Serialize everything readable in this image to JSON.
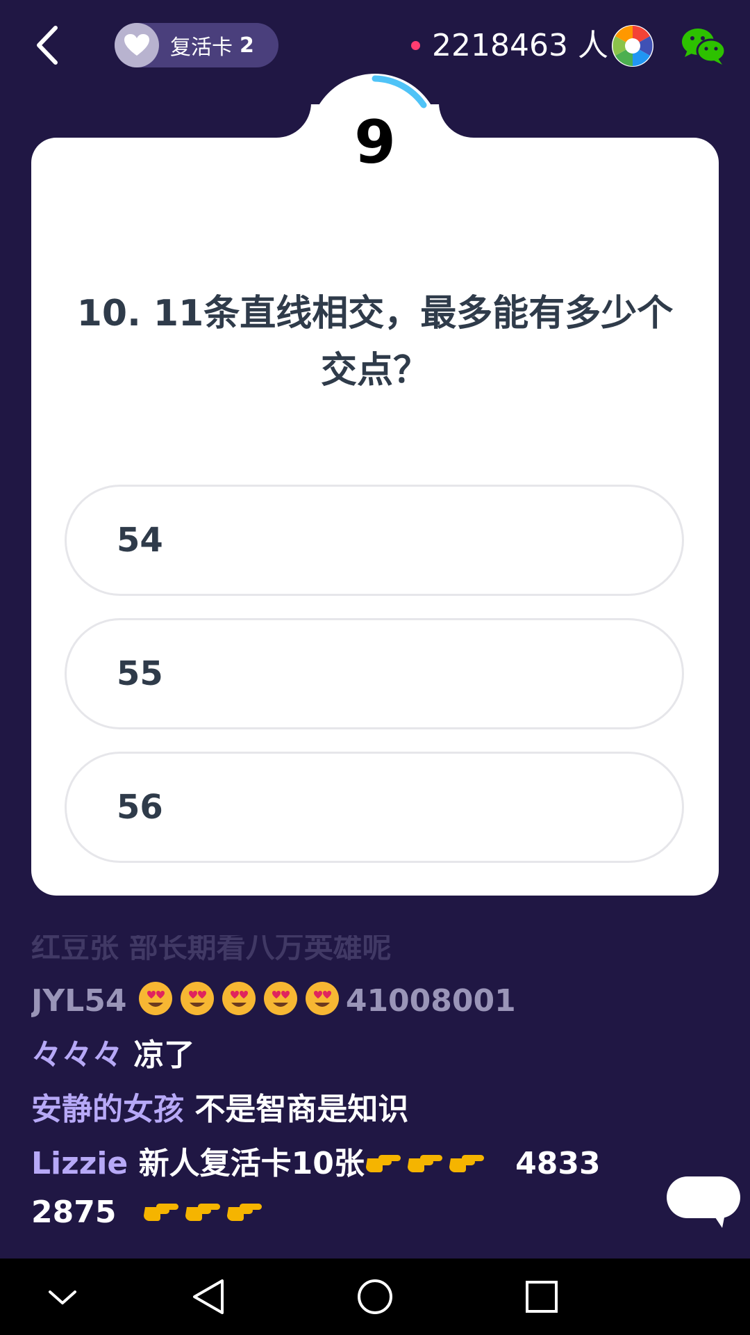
{
  "header": {
    "revive_card_label": "复活卡",
    "revive_card_count": "2",
    "viewer_count": "2218463 人",
    "icons": [
      "back-arrow-icon",
      "heart-icon",
      "live-dot",
      "aperture-icon",
      "wechat-icon"
    ]
  },
  "timer": {
    "seconds_left": "9"
  },
  "question": {
    "text": "10. 11条直线相交，最多能有多少个交点？",
    "options": [
      "54",
      "55",
      "56"
    ]
  },
  "comments": {
    "faded_line": "红豆张 部长期看八万英雄呢",
    "items": [
      {
        "user": "JYL54",
        "emoji": "smiling-face-with-heart-eyes x5",
        "text": "41008001"
      },
      {
        "user": "々々々",
        "text": "凉了"
      },
      {
        "user": "安静的女孩",
        "text": "不是智商是知识"
      },
      {
        "user": "Lizzie",
        "text": "新人复活卡10张",
        "text_after": "4833",
        "text_line2": "2875"
      }
    ]
  },
  "colors": {
    "background": "#201744",
    "card": "#ffffff",
    "text_dark": "#2f3b4a",
    "username": "#b7a9f7",
    "live_dot": "#ff3d71",
    "timer_arc": "#4fc3f7"
  }
}
